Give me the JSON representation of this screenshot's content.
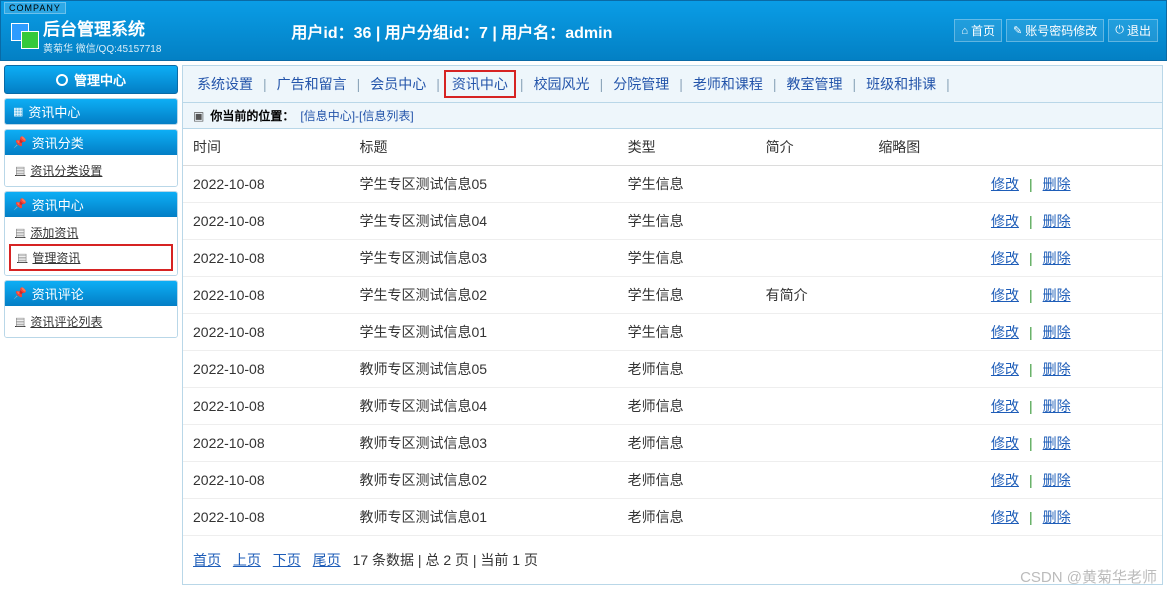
{
  "header": {
    "company_badge": "COMPANY",
    "title": "后台管理系统",
    "subtitle": "黄菊华 微信/QQ:45157718",
    "center_text": "用户id：36 | 用户分组id：7 | 用户名：admin",
    "btn_home": "首页",
    "btn_password": "账号密码修改",
    "btn_logout": "退出"
  },
  "sidebar": {
    "center_title": "管理中心",
    "panels": [
      {
        "title": "资讯中心",
        "icon": "grid",
        "items": []
      },
      {
        "title": "资讯分类",
        "icon": "pin",
        "items": [
          {
            "label": "资讯分类设置",
            "highlight": false
          }
        ]
      },
      {
        "title": "资讯中心",
        "icon": "pin",
        "items": [
          {
            "label": "添加资讯",
            "highlight": false
          },
          {
            "label": "管理资讯",
            "highlight": true
          }
        ]
      },
      {
        "title": "资讯评论",
        "icon": "pin",
        "items": [
          {
            "label": "资讯评论列表",
            "highlight": false
          }
        ]
      }
    ]
  },
  "topnav": {
    "items": [
      {
        "label": "系统设置",
        "active": false
      },
      {
        "label": "广告和留言",
        "active": false
      },
      {
        "label": "会员中心",
        "active": false
      },
      {
        "label": "资讯中心",
        "active": true
      },
      {
        "label": "校园风光",
        "active": false
      },
      {
        "label": "分院管理",
        "active": false
      },
      {
        "label": "老师和课程",
        "active": false
      },
      {
        "label": "教室管理",
        "active": false
      },
      {
        "label": "班级和排课",
        "active": false
      }
    ]
  },
  "breadcrumb": {
    "prefix": "你当前的位置：",
    "path": "[信息中心]-[信息列表]"
  },
  "table": {
    "columns": [
      "时间",
      "标题",
      "类型",
      "简介",
      "缩略图"
    ],
    "action_edit": "修改",
    "action_delete": "删除",
    "rows": [
      {
        "time": "2022-10-08",
        "title": "学生专区测试信息05",
        "type": "学生信息",
        "intro": "",
        "thumb": ""
      },
      {
        "time": "2022-10-08",
        "title": "学生专区测试信息04",
        "type": "学生信息",
        "intro": "",
        "thumb": ""
      },
      {
        "time": "2022-10-08",
        "title": "学生专区测试信息03",
        "type": "学生信息",
        "intro": "",
        "thumb": ""
      },
      {
        "time": "2022-10-08",
        "title": "学生专区测试信息02",
        "type": "学生信息",
        "intro": "有简介",
        "thumb": ""
      },
      {
        "time": "2022-10-08",
        "title": "学生专区测试信息01",
        "type": "学生信息",
        "intro": "",
        "thumb": ""
      },
      {
        "time": "2022-10-08",
        "title": "教师专区测试信息05",
        "type": "老师信息",
        "intro": "",
        "thumb": ""
      },
      {
        "time": "2022-10-08",
        "title": "教师专区测试信息04",
        "type": "老师信息",
        "intro": "",
        "thumb": ""
      },
      {
        "time": "2022-10-08",
        "title": "教师专区测试信息03",
        "type": "老师信息",
        "intro": "",
        "thumb": ""
      },
      {
        "time": "2022-10-08",
        "title": "教师专区测试信息02",
        "type": "老师信息",
        "intro": "",
        "thumb": ""
      },
      {
        "time": "2022-10-08",
        "title": "教师专区测试信息01",
        "type": "老师信息",
        "intro": "",
        "thumb": ""
      }
    ]
  },
  "pager": {
    "first": "首页",
    "prev": "上页",
    "next": "下页",
    "last": "尾页",
    "summary": "17 条数据 | 总 2 页 | 当前 1 页"
  },
  "watermark": "CSDN @黄菊华老师"
}
